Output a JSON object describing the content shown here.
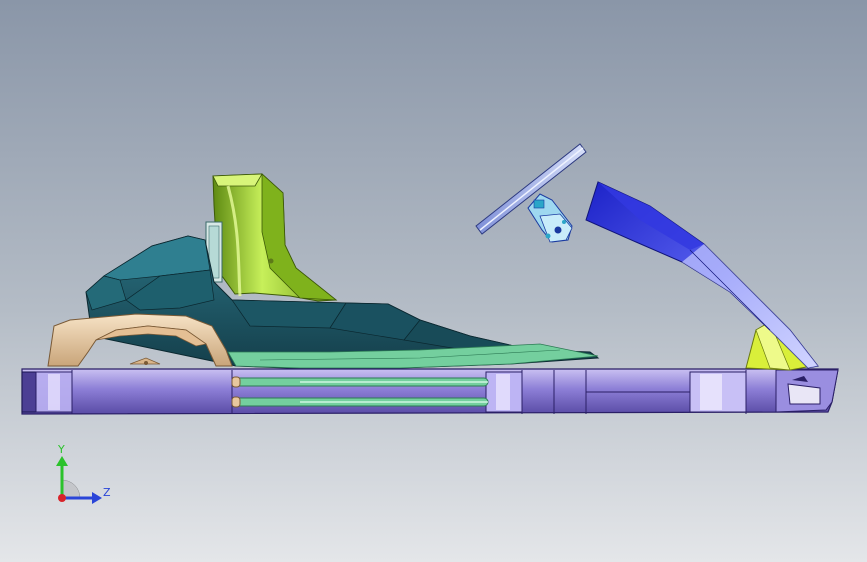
{
  "viewport": {
    "background_top": "#8a96a8",
    "background_bottom": "#e4e6e9"
  },
  "model": {
    "parts": [
      "chassis-frame",
      "seat",
      "body-shell",
      "front-bumper",
      "steering-wheel",
      "steering-column",
      "nose-fairing",
      "nose-bracket"
    ],
    "colors": {
      "chassis": "#8c7ed6",
      "seat": "#8fbf2a",
      "body": "#1f5a68",
      "bumper": "#e8c79e",
      "steering_wheel": "#a7b6ea",
      "fairing": "#2a2fd8",
      "bracket": "#d9ef3a",
      "rail": "#74cf9e"
    }
  },
  "triad": {
    "y_label": "Y",
    "z_label": "Z",
    "y_color": "#2bc22b",
    "z_color": "#2a45d8",
    "x_color": "#d8232a"
  }
}
